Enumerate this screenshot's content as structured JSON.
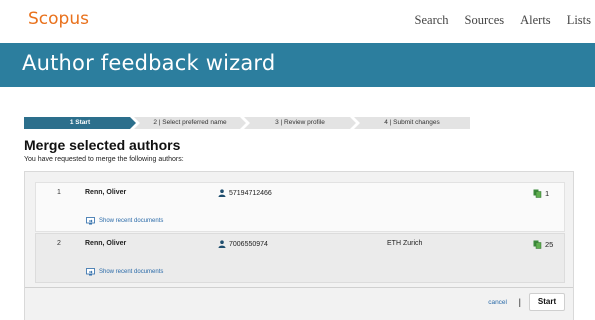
{
  "brand": {
    "logo_text": "Scopus",
    "logo_color": "#e9711c"
  },
  "nav": {
    "items": [
      "Search",
      "Sources",
      "Alerts",
      "Lists"
    ]
  },
  "banner": {
    "title": "Author feedback wizard",
    "color": "#2c7e9e"
  },
  "steps": [
    {
      "label": "1  Start",
      "active": true
    },
    {
      "label": "2 | Select preferred name",
      "active": false
    },
    {
      "label": "3 | Review profile",
      "active": false
    },
    {
      "label": "4 | Submit changes",
      "active": false
    }
  ],
  "heading": "Merge selected authors",
  "subheading": "You have requested to merge the following authors:",
  "authors": [
    {
      "num": "1",
      "name": "Renn, Oliver",
      "author_id": "57194712466",
      "affiliation": "",
      "docs": "1",
      "recent_link": "Show recent documents"
    },
    {
      "num": "2",
      "name": "Renn, Oliver",
      "author_id": "7006550974",
      "affiliation": "ETH Zurich",
      "docs": "25",
      "recent_link": "Show recent documents"
    }
  ],
  "footer": {
    "cancel": "cancel",
    "separator": "|",
    "start": "Start"
  },
  "icons": {
    "author": "person-icon",
    "documents": "documents-icon",
    "recent": "monitor-arrow-icon"
  }
}
